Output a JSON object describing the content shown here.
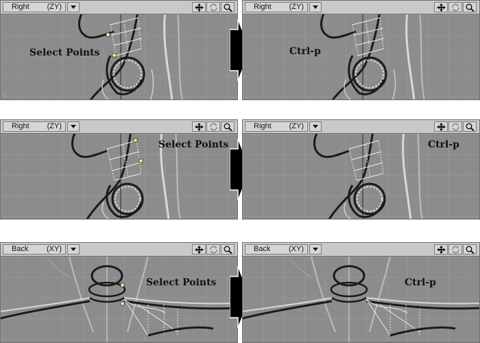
{
  "rows": [
    {
      "left": {
        "view": "Right",
        "axis": "(ZY)",
        "label": "Select Points"
      },
      "right": {
        "view": "Right",
        "axis": "(ZY)",
        "label": "Ctrl-p"
      }
    },
    {
      "left": {
        "view": "Right",
        "axis": "(ZY)",
        "label": "Select Points"
      },
      "right": {
        "view": "Right",
        "axis": "(ZY)",
        "label": "Ctrl-p"
      }
    },
    {
      "left": {
        "view": "Back",
        "axis": "(XY)",
        "label": "Select Points"
      },
      "right": {
        "view": "Back",
        "axis": "(XY)",
        "label": "Ctrl-p"
      }
    }
  ],
  "toolbar_icons": [
    "move-icon",
    "rotate-icon",
    "zoom-icon"
  ],
  "colors": {
    "viewport_bg": "#8c8c8c",
    "toolbar_bg": "#c9c9c9",
    "grid": "#9a9a9a",
    "wire_dark": "#1a1a1a",
    "wire_light": "#e8e8e8",
    "selected_point": "#f2f2a0"
  }
}
